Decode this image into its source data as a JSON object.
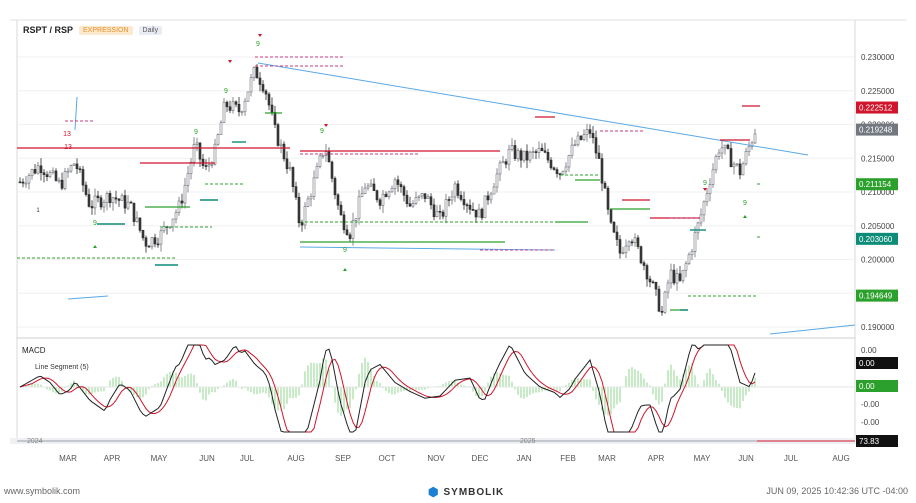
{
  "header": {
    "symbol": "RSPT / RSP",
    "badge1": "EXPRESSION",
    "badge2": "Daily"
  },
  "chart_data": {
    "type": "candlestick",
    "y_ticks": [
      "0.230000",
      "0.225000",
      "0.220000",
      "0.215000",
      "0.210000",
      "0.205000",
      "0.200000",
      "0.195000",
      "0.190000"
    ],
    "price_tags": [
      {
        "label": "0.222512",
        "color": "#d0152c",
        "value": 0.222512
      },
      {
        "label": "0.219248",
        "color": "#737780",
        "value": 0.219248
      },
      {
        "label": "0.211154",
        "color": "#2ca02c",
        "value": 0.211154
      },
      {
        "label": "0.203060",
        "color": "#0e8c7a",
        "value": 0.20306
      },
      {
        "label": "0.194649",
        "color": "#2ca02c",
        "value": 0.194649
      }
    ],
    "x_labels": [
      "MAR",
      "APR",
      "MAY",
      "JUN",
      "JUL",
      "AUG",
      "SEP",
      "OCT",
      "NOV",
      "DEC",
      "JAN",
      "FEB",
      "MAR",
      "APR",
      "MAY",
      "JUN",
      "JUL",
      "AUG"
    ],
    "sequential_marks": [
      "13",
      "13",
      "9",
      "9",
      "9",
      "9",
      "9",
      "9",
      "9",
      "9"
    ],
    "minor_marks": [
      "1"
    ],
    "macd": {
      "title": "MACD",
      "legend": "Line Segment (5)",
      "ticks": [
        "0.00",
        "0.00",
        "-0.00",
        "-0.00"
      ],
      "tag_black": "0.00",
      "tag_green": "0.00"
    },
    "timeline": {
      "year1": "2024",
      "year2": "2025",
      "value": "73.83"
    }
  },
  "footer": {
    "left": "www.symbolik.com",
    "brand": "SYMBOLIK",
    "right": "JUN 09, 2025 10:42:36 UTC -04:00"
  }
}
